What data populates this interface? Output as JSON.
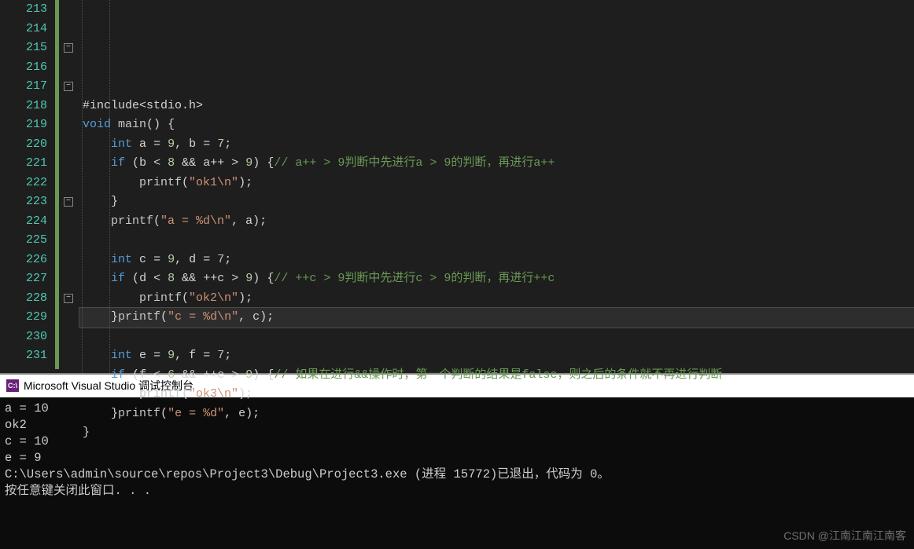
{
  "editor": {
    "line_start": 213,
    "lines": [
      {
        "n": 213,
        "html": ""
      },
      {
        "n": 214,
        "html": "<span class='op'>#include</span><span class='pn'>&lt;</span><span class='id'>stdio.h</span><span class='pn'>&gt;</span>"
      },
      {
        "n": 215,
        "fold": true,
        "html": "<span class='kw'>void</span> <span class='fn'>main</span><span class='pn'>()</span> <span class='pn'>{</span>"
      },
      {
        "n": 216,
        "indent": 1,
        "html": "    <span class='kw'>int</span> <span class='id'>a</span> <span class='op'>=</span> <span class='num'>9</span><span class='pn'>,</span> <span class='id'>b</span> <span class='op'>=</span> <span class='num'>7</span><span class='pn'>;</span>"
      },
      {
        "n": 217,
        "fold": true,
        "indent": 1,
        "html": "    <span class='kw'>if</span> <span class='pn'>(</span><span class='id'>b</span> <span class='op'>&lt;</span> <span class='num'>8</span> <span class='op'>&amp;&amp;</span> <span class='id'>a</span><span class='op'>++</span> <span class='op'>&gt;</span> <span class='num'>9</span><span class='pn'>)</span> <span class='pn'>{</span><span class='cm'>// a++ &gt; 9判断中先进行a &gt; 9的判断，再进行a++</span>"
      },
      {
        "n": 218,
        "indent": 2,
        "html": "        <span class='fn'>printf</span><span class='pn'>(</span><span class='str'>\"ok1\\n\"</span><span class='pn'>);</span>"
      },
      {
        "n": 219,
        "indent": 1,
        "html": "    <span class='pn'>}</span>"
      },
      {
        "n": 220,
        "indent": 1,
        "html": "    <span class='fn'>printf</span><span class='pn'>(</span><span class='str'>\"a = %d\\n\"</span><span class='pn'>,</span> <span class='id'>a</span><span class='pn'>);</span>"
      },
      {
        "n": 221,
        "html": ""
      },
      {
        "n": 222,
        "indent": 1,
        "html": "    <span class='kw'>int</span> <span class='id'>c</span> <span class='op'>=</span> <span class='num'>9</span><span class='pn'>,</span> <span class='id'>d</span> <span class='op'>=</span> <span class='num'>7</span><span class='pn'>;</span>"
      },
      {
        "n": 223,
        "fold": true,
        "indent": 1,
        "html": "    <span class='kw'>if</span> <span class='pn'>(</span><span class='id'>d</span> <span class='op'>&lt;</span> <span class='num'>8</span> <span class='op'>&amp;&amp;</span> <span class='op'>++</span><span class='id'>c</span> <span class='op'>&gt;</span> <span class='num'>9</span><span class='pn'>)</span> <span class='pn'>{</span><span class='cm'>// ++c &gt; 9判断中先进行c &gt; 9的判断，再进行++c</span>"
      },
      {
        "n": 224,
        "indent": 2,
        "html": "        <span class='fn'>printf</span><span class='pn'>(</span><span class='str'>\"ok2\\n\"</span><span class='pn'>);</span>"
      },
      {
        "n": 225,
        "highlight": true,
        "indent": 1,
        "html": "    <span class='pn'>}</span><span class='fn'>printf</span><span class='pn'>(</span><span class='str'>\"c = %d\\n\"</span><span class='pn'>,</span> <span class='id'>c</span><span class='pn'>);</span>"
      },
      {
        "n": 226,
        "html": ""
      },
      {
        "n": 227,
        "indent": 1,
        "html": "    <span class='kw'>int</span> <span class='id'>e</span> <span class='op'>=</span> <span class='num'>9</span><span class='pn'>,</span> <span class='id'>f</span> <span class='op'>=</span> <span class='num'>7</span><span class='pn'>;</span>"
      },
      {
        "n": 228,
        "fold": true,
        "indent": 1,
        "html": "    <span class='kw'>if</span> <span class='pn'>(</span><span class='id'>f</span> <span class='op'>&lt;</span> <span class='num'>6</span> <span class='op'>&amp;&amp;</span> <span class='op'>++</span><span class='id'>e</span> <span class='op'>&gt;</span> <span class='num'>9</span><span class='pn'>)</span> <span class='pn'>{</span><span class='cm'>// 如果在进行&amp;&amp;操作时，第一个判断的结果是false，则之后的条件就不再进行判断</span>"
      },
      {
        "n": 229,
        "indent": 2,
        "html": "        <span class='fn'>printf</span><span class='pn'>(</span><span class='str'>\"ok3\\n\"</span><span class='pn'>);</span>"
      },
      {
        "n": 230,
        "indent": 1,
        "html": "    <span class='pn'>}</span><span class='fn'>printf</span><span class='pn'>(</span><span class='str'>\"e = %d\"</span><span class='pn'>,</span> <span class='id'>e</span><span class='pn'>);</span>"
      },
      {
        "n": 231,
        "html": "<span class='pn'>}</span>"
      }
    ]
  },
  "console": {
    "icon_text": "C:\\",
    "title": "Microsoft Visual Studio 调试控制台",
    "output": "a = 10\nok2\nc = 10\ne = 9\nC:\\Users\\admin\\source\\repos\\Project3\\Debug\\Project3.exe (进程 15772)已退出，代码为 0。\n按任意键关闭此窗口. . ."
  },
  "watermark": "CSDN @江南江南江南客"
}
